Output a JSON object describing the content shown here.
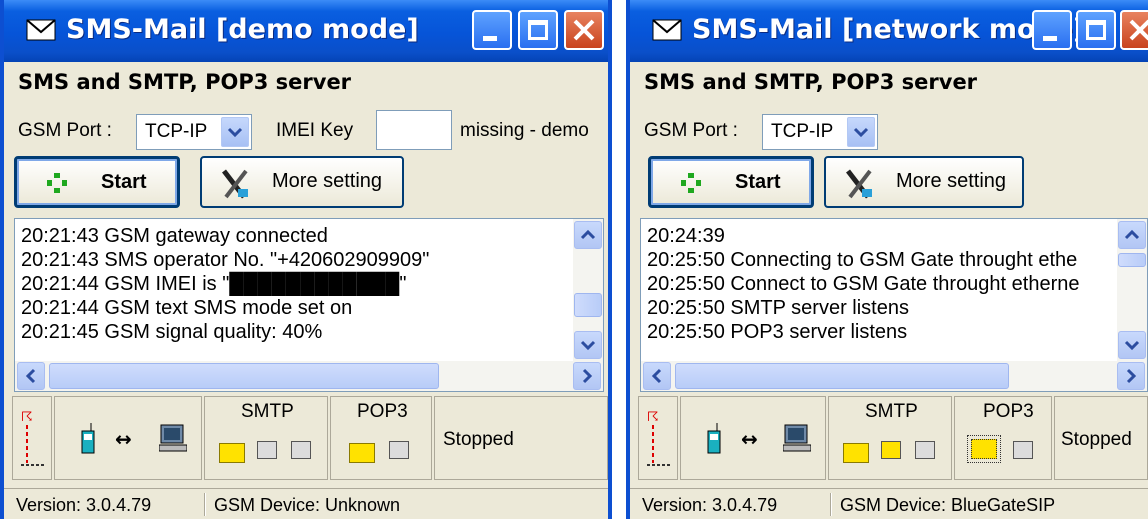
{
  "windows": [
    {
      "title": "SMS-Mail  [demo mode]",
      "server_label": "SMS and SMTP, POP3 server",
      "gsm_port_label": "GSM Port :",
      "gsm_port_value": "TCP-IP",
      "imei_key_label": "IMEI Key",
      "imei_status": "missing - demo",
      "start_label": "Start",
      "more_label": "More setting",
      "log": [
        "20:21:43  GSM gateway connected",
        "20:21:43  SMS operator No. \"+420602909909\"",
        "20:21:44  GSM IMEI is \"████████████\"",
        "20:21:44  GSM text SMS mode set on",
        "20:21:45  GSM signal quality: 40%"
      ],
      "smtp_label": "SMTP",
      "pop3_label": "POP3",
      "state": "Stopped",
      "version": "Version: 3.0.4.79",
      "device": "GSM Device: Unknown"
    },
    {
      "title": "SMS-Mail  [network mode]",
      "server_label": "SMS and SMTP, POP3 server",
      "gsm_port_label": "GSM Port :",
      "gsm_port_value": "TCP-IP",
      "start_label": "Start",
      "more_label": "More setting",
      "log": [
        "20:24:39",
        "20:25:50  Connecting to GSM Gate throught ethe",
        "20:25:50  Connect to GSM Gate throught etherne",
        "20:25:50  SMTP server listens",
        "20:25:50  POP3 server listens"
      ],
      "smtp_label": "SMTP",
      "pop3_label": "POP3",
      "state": "Stopped",
      "version": "Version: 3.0.4.79",
      "device": "GSM Device: BlueGateSIP"
    }
  ],
  "colors": {
    "titlebar": "#0654d8",
    "face": "#ece9d8",
    "close": "#c9431d"
  },
  "icons": [
    "mail-icon",
    "minimize-icon",
    "maximize-icon",
    "close-icon",
    "dropdown-arrow-icon",
    "start-icon",
    "tools-icon",
    "antenna-icon",
    "phone-icon",
    "link-arrows-icon",
    "computer-icon",
    "folder-icon",
    "clock-icon",
    "mail-stack-icon"
  ]
}
